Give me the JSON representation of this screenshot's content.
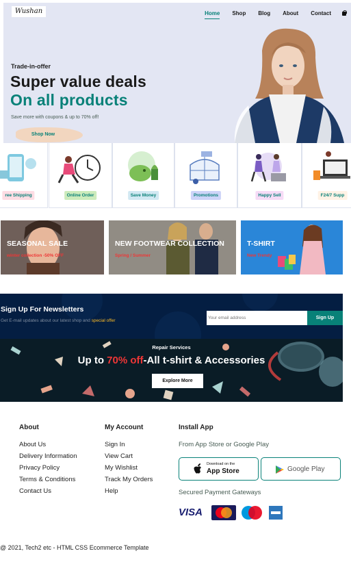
{
  "nav": {
    "logo": "Wushan",
    "links": [
      "Home",
      "Shop",
      "Blog",
      "About",
      "Contact"
    ],
    "active": "Home"
  },
  "hero": {
    "subtitle": "Trade-in-offer",
    "title_line1": "Super value deals",
    "title_line2": "On all products",
    "text": "Save more with coupons & up to 70% off!",
    "button": "Shop Now"
  },
  "features": [
    {
      "label": "ree Shipping",
      "bg": "#fddde4"
    },
    {
      "label": "Online Order",
      "bg": "#cdebbc"
    },
    {
      "label": "Save Money",
      "bg": "#d1e8f2"
    },
    {
      "label": "Promotions",
      "bg": "#cdd4f8"
    },
    {
      "label": "Happy Sell",
      "bg": "#f6dbf6"
    },
    {
      "label": "F24/7 Supp",
      "bg": "#fff2e5"
    }
  ],
  "banners": [
    {
      "title": "SEASONAL SALE",
      "sub": "winter collection -50% OFF"
    },
    {
      "title": "NEW FOOTWEAR COLLECTION",
      "sub": "Spring / Summer"
    },
    {
      "title": "T-SHIRT",
      "sub": "New Trendy"
    }
  ],
  "newsletter": {
    "title": "Sign Up For Newsletters",
    "text_before": "Get E-mail updates about our latest shop and ",
    "text_highlight": "special offer",
    "placeholder": "Your email address",
    "button": "Sign Up"
  },
  "repair": {
    "subtitle": "Repair Services",
    "title_before": "Up to ",
    "title_highlight": "70% off",
    "title_after": "-All t-shirt & Accessories",
    "button": "Explore More"
  },
  "footer": {
    "about": {
      "title": "About",
      "links": [
        "About Us",
        "Delivery Information",
        "Privacy Policy",
        "Terms & Conditions",
        "Contact Us"
      ]
    },
    "account": {
      "title": "My Account",
      "links": [
        "Sign In",
        "View Cart",
        "My Wishlist",
        "Track My Orders",
        "Help"
      ]
    },
    "install": {
      "title": "Install App",
      "note": "From App Store or Google Play",
      "appstore_small": "Download on the",
      "appstore_big": "App Store",
      "googleplay": "Google Play",
      "payments_note": "Secured Payment Gateways",
      "payments": [
        "VISA",
        "MasterCard",
        "Maestro",
        "American Express"
      ]
    },
    "copyright": "@ 2021, Tech2 etc - HTML CSS Ecommerce Template"
  },
  "colors": {
    "accent": "#088178",
    "nav_bg": "#e3e6f3",
    "dark_navy": "#041e42",
    "sale_red": "#ef3636"
  }
}
